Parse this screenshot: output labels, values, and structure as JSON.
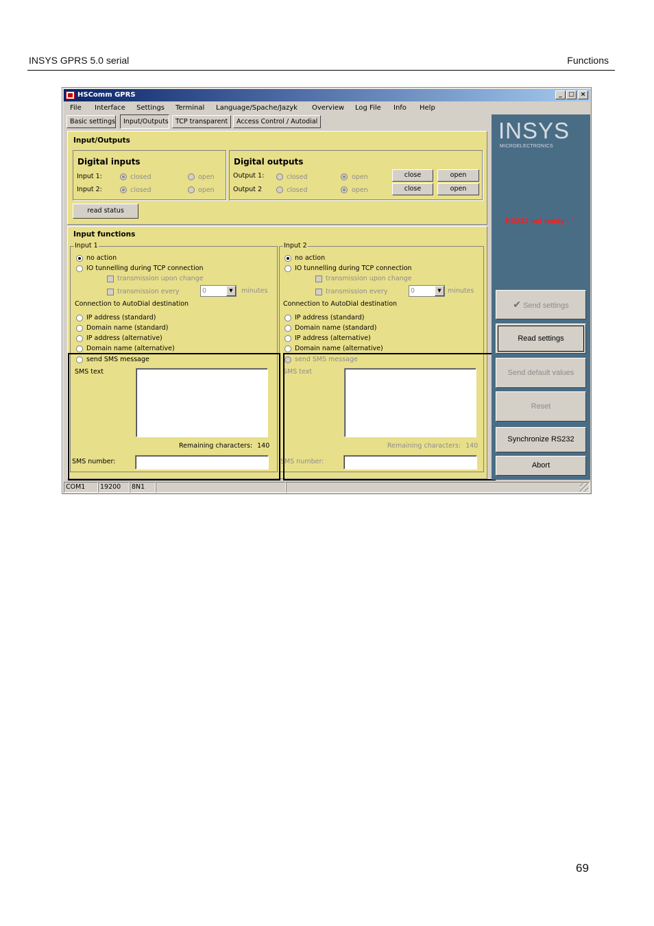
{
  "doc": {
    "header_left": "INSYS GPRS 5.0 serial",
    "header_right": "Functions",
    "page_number": "69"
  },
  "window": {
    "title": "HSComm GPRS",
    "controls": [
      "_",
      "□",
      "×"
    ]
  },
  "menu": [
    "File",
    "Interface",
    "Settings",
    "Terminal",
    "Language/Spache/Jazyk",
    "Overview",
    "Log File",
    "Info",
    "Help"
  ],
  "tabs": [
    "Basic settings",
    "Input/Outputs",
    "TCP transparent",
    "Access Control / Autodial"
  ],
  "active_tab": "Input/Outputs",
  "io": {
    "section_title": "Input/Outputs",
    "digital_inputs": {
      "title": "Digital inputs",
      "rows": [
        {
          "label": "Input 1:",
          "closed": "closed",
          "open": "open",
          "selected": "closed"
        },
        {
          "label": "Input 2:",
          "closed": "closed",
          "open": "open",
          "selected": "closed"
        }
      ]
    },
    "digital_outputs": {
      "title": "Digital outputs",
      "rows": [
        {
          "label": "Output 1:",
          "closed": "closed",
          "open": "open",
          "selected": "open",
          "btn_close": "close",
          "btn_open": "open"
        },
        {
          "label": "Output 2",
          "closed": "closed",
          "open": "open",
          "selected": "open",
          "btn_close": "close",
          "btn_open": "open"
        }
      ]
    },
    "read_status": "read status"
  },
  "input_functions": {
    "title": "Input functions",
    "panels": [
      {
        "name": "Input 1",
        "no_action": "no action",
        "io_tunnel": "IO tunnelling during TCP connection",
        "trans_change": "transmission upon change",
        "trans_every": "transmission every",
        "interval": "0",
        "minutes": "minutes",
        "conn_label": "Connection to AutoDial destination",
        "ip_std": "IP address (standard)",
        "dom_std": "Domain name (standard)",
        "ip_alt": "IP address (alternative)",
        "dom_alt": "Domain name (alternative)",
        "send_sms": "send SMS message",
        "sms_text": "SMS text",
        "remaining": "Remaining characters:",
        "remaining_count": "140",
        "sms_number": "SMS number:"
      },
      {
        "name": "Input 2",
        "no_action": "no action",
        "io_tunnel": "IO tunnelling during TCP connection",
        "trans_change": "transmission upon change",
        "trans_every": "transmission every",
        "interval": "0",
        "minutes": "minutes",
        "conn_label": "Connection to AutoDial destination",
        "ip_std": "IP address (standard)",
        "dom_std": "Domain name (standard)",
        "ip_alt": "IP address (alternative)",
        "dom_alt": "Domain name (alternative)",
        "send_sms": "send SMS message",
        "sms_text": "SMS text",
        "remaining": "Remaining characters:",
        "remaining_count": "140",
        "sms_number": "SMS number:"
      }
    ]
  },
  "side": {
    "logo": "INSYS",
    "logo_sub": "MICROELECTRONICS",
    "status": "RS232 not ready - '",
    "send_settings": "Send settings",
    "read_settings": "Read settings",
    "send_default": "Send default values",
    "reset": "Reset",
    "sync": "Synchronize RS232",
    "abort": "Abort"
  },
  "statusbar": [
    "COM1",
    "19200",
    "8N1"
  ]
}
